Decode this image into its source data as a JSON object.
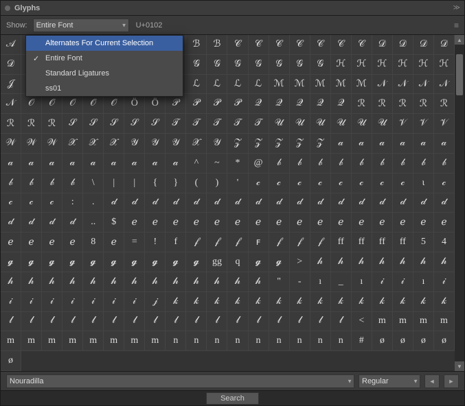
{
  "titleBar": {
    "title": "Glyphs",
    "collapseIcon": "≫"
  },
  "toolbar": {
    "showLabel": "Show:",
    "showOptions": [
      "Entire Font",
      "Alternates For Current Selection",
      "Standard Ligatures",
      "ss01"
    ],
    "showSelected": "Entire Font",
    "unicodeValue": "U+0102",
    "menuIcon": "≡"
  },
  "dropdownMenu": {
    "items": [
      {
        "label": "Alternates For Current Selection",
        "checked": false,
        "selected": true
      },
      {
        "label": "Entire Font",
        "checked": true,
        "selected": false
      },
      {
        "label": "Standard Ligatures",
        "checked": false,
        "selected": false
      },
      {
        "label": "ss01",
        "checked": false,
        "selected": false
      }
    ]
  },
  "glyphs": [
    "𝒜",
    "𝒜",
    "𝒜",
    "𝒜",
    "𝒜",
    "ℬ",
    "ℬ",
    "ℬ",
    "ℬ",
    "ℬ",
    "ℬ",
    "𝒞",
    "𝒞",
    "𝒞",
    "𝒞",
    "𝒞",
    "𝒞",
    "𝒞",
    "𝒟",
    "𝒟",
    "𝒟",
    "𝒟",
    "𝒟",
    "ℰ",
    "ℰ",
    "ℰ",
    "ℰ",
    "ℱ",
    "ℱ",
    "ℱ",
    "ℱ",
    "𝒢",
    "𝒢",
    "𝒢",
    "𝒢",
    "𝒢",
    "𝒢",
    "𝒢",
    "ℋ",
    "ℋ",
    "ℋ",
    "ℋ",
    "ℋ",
    "ℋ",
    "𝒥",
    "ℐ",
    "ℐ",
    "ℐ",
    "𝒦",
    "𝒦",
    "ℒ",
    "ℒ",
    "ℒ",
    "ℒ",
    "ℒ",
    "ℒ",
    "ℒ",
    "ℳ",
    "ℳ",
    "ℳ",
    "ℳ",
    "ℳ",
    "𝒩",
    "𝒩",
    "𝒩",
    "𝒩",
    "𝒩",
    "𝒪",
    "𝒪",
    "𝒪",
    "𝒪",
    "𝒪",
    "Ö",
    "Ö",
    "𝒫",
    "𝒫",
    "𝒫",
    "𝒫",
    "𝒬",
    "𝒬",
    "𝒬",
    "𝒬",
    "𝒬",
    "ℛ",
    "ℛ",
    "ℛ",
    "ℛ",
    "ℛ",
    "ℛ",
    "ℛ",
    "ℛ",
    "𝒮",
    "𝒮",
    "𝒮",
    "𝒮",
    "𝒮",
    "𝒯",
    "𝒯",
    "𝒯",
    "𝒯",
    "𝒯",
    "𝒰",
    "𝒰",
    "𝒰",
    "𝒰",
    "𝒰",
    "𝒰",
    "𝒱",
    "𝒱",
    "𝒱",
    "𝒲",
    "𝒲",
    "𝒲",
    "𝒳",
    "𝒳",
    "𝒳",
    "𝒴",
    "𝒴",
    "𝒴",
    "𝒳",
    "𝒴",
    "𝒵",
    "𝒵",
    "𝒵",
    "𝒵",
    "𝒵",
    "𝒶",
    "𝒶",
    "𝒶",
    "𝒶",
    "𝒶",
    "𝒶",
    "𝒶",
    "𝒶",
    "𝒶",
    "𝒶",
    "𝒶",
    "𝒶",
    "𝒶",
    "𝒶",
    "𝒶",
    "^",
    "~",
    "*",
    "@",
    "𝒷",
    "𝒷",
    "𝒷",
    "𝒷",
    "𝒷",
    "𝒷",
    "𝒷",
    "𝒷",
    "𝒷",
    "𝒷",
    "𝒷",
    "𝒷",
    "𝒷",
    "\\",
    "|",
    "|",
    "{",
    "}",
    "(",
    ")",
    "'",
    "𝒸",
    "𝒸",
    "𝒸",
    "𝒸",
    "𝒸",
    "𝒸",
    "𝒸",
    "𝒸",
    "ɩ",
    "𝒸",
    "𝒸",
    "𝒸",
    "𝒸",
    ":",
    ".",
    "𝒹",
    "𝒹",
    "𝒹",
    "𝒹",
    "𝒹",
    "𝒹",
    "𝒹",
    "𝒹",
    "𝒹",
    "𝒹",
    "𝒹",
    "𝒹",
    "𝒹",
    "𝒹",
    "𝒹",
    "𝒹",
    "𝒹",
    "𝒹",
    "𝒹",
    "𝒹",
    "𝒹",
    "..",
    "$",
    "ℯ",
    "ℯ",
    "ℯ",
    "ℯ",
    "ℯ",
    "ℯ",
    "ℯ",
    "ℯ",
    "ℯ",
    "ℯ",
    "ℯ",
    "ℯ",
    "ℯ",
    "ℯ",
    "ℯ",
    "ℯ",
    "ℯ",
    "ℯ",
    "ℯ",
    "ℯ",
    "8",
    "ℯ",
    "=",
    "!",
    "f",
    "𝒻",
    "𝒻",
    "𝒻",
    "ꜰ",
    "𝒻",
    "𝒻",
    "𝒻",
    "ff",
    "ff",
    "ff",
    "ff",
    "5",
    "4",
    "𝓰",
    "𝓰",
    "𝓰",
    "𝓰",
    "𝓰",
    "𝓰",
    "𝓰",
    "𝓰",
    "𝓰",
    "𝓰",
    "gg",
    "q",
    "𝓰",
    "𝓰",
    ">",
    "𝒽",
    "𝒽",
    "𝒽",
    "𝒽",
    "𝒽",
    "𝒽",
    "𝒽",
    "𝒽",
    "𝒽",
    "𝒽",
    "𝒽",
    "𝒽",
    "𝒽",
    "𝒽",
    "𝒽",
    "𝒽",
    "𝒽",
    "𝒽",
    "𝒽",
    "𝒽",
    "\"",
    "-",
    "ı",
    "_",
    "ı",
    "𝒾",
    "𝒾",
    "ı",
    "𝒾",
    "𝒾",
    "𝒾",
    "𝒾",
    "𝒾",
    "𝒾",
    "𝒾",
    "𝒾",
    "𝒿",
    "𝓀",
    "𝓀",
    "𝓀",
    "𝓀",
    "𝓀",
    "𝓀",
    "𝓀",
    "𝓀",
    "𝓀",
    "𝓀",
    "𝓀",
    "𝓀",
    "𝓀",
    "𝓀",
    "𝓁",
    "𝓁",
    "𝓁",
    "𝓁",
    "𝓁",
    "𝓁",
    "𝓁",
    "𝓁",
    "𝓁",
    "𝓁",
    "𝓁",
    "𝓁",
    "𝓁",
    "𝓁",
    "𝓁",
    "𝓁",
    "𝓁",
    "<",
    "m",
    "m",
    "m",
    "m",
    "m",
    "m",
    "m",
    "m",
    "m",
    "m",
    "m",
    "m",
    "n",
    "n",
    "n",
    "n",
    "n",
    "n",
    "n",
    "n",
    "n",
    "#",
    "ø",
    "ø",
    "ø",
    "ø",
    "ø"
  ],
  "bottomBar": {
    "fontName": "Nouradilla",
    "styleName": "Regular",
    "prevLabel": "◄",
    "nextLabel": "►"
  },
  "statusBar": {
    "searchLabel": "Search"
  }
}
